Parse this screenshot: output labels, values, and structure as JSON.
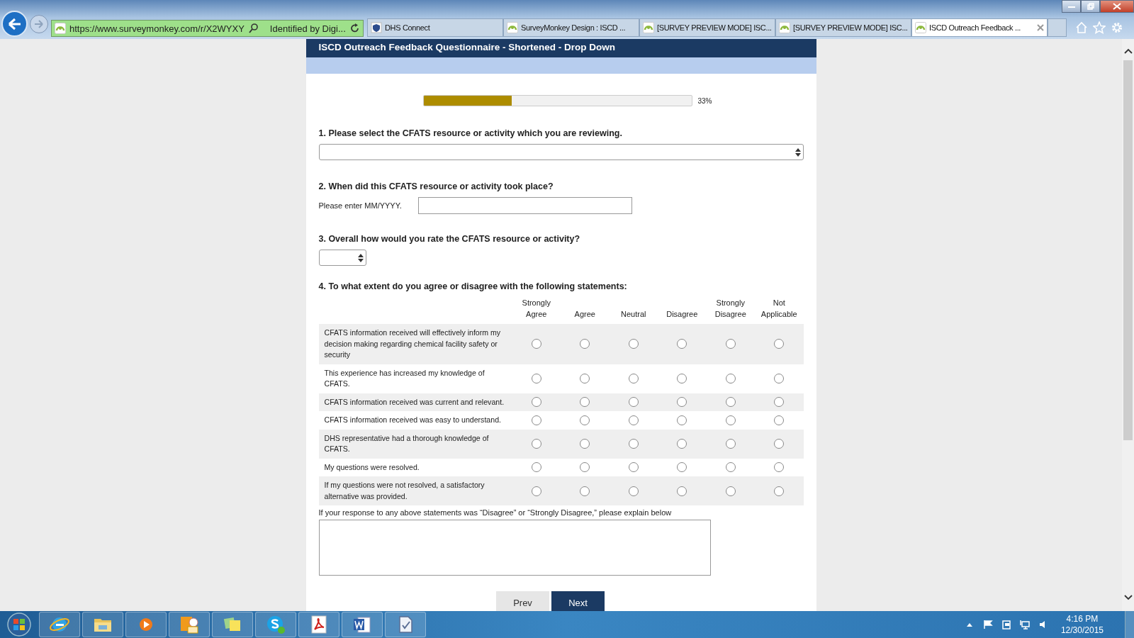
{
  "browser": {
    "address": "https://www.surveymonkey.com/r/X2WYXY",
    "identity": "Identified by Digi...",
    "tabs": [
      {
        "title": "DHS Connect",
        "selected": false
      },
      {
        "title": "SurveyMonkey Design : ISCD ...",
        "selected": false
      },
      {
        "title": "[SURVEY PREVIEW MODE] ISC...",
        "selected": false
      },
      {
        "title": "[SURVEY PREVIEW MODE] ISC...",
        "selected": false
      },
      {
        "title": "ISCD Outreach Feedback ...",
        "selected": true
      }
    ]
  },
  "survey": {
    "title": "ISCD Outreach Feedback Questionnaire - Shortened - Drop Down",
    "progress": {
      "level": 0.33,
      "label": "33%"
    },
    "questions": [
      {
        "kind": "dropdown",
        "title": "1. Please select the CFATS resource or activity which you are reviewing."
      },
      {
        "kind": "date",
        "title": "2. When did this CFATS resource or activity took place?",
        "prompt": "Please enter MM/YYYY."
      },
      {
        "kind": "rating",
        "title": "3. Overall how would you rate the CFATS resource or activity?"
      },
      {
        "kind": "matrix",
        "title": "4. To what extent do you agree or disagree with the following statements:",
        "columns": [
          "Strongly Agree",
          "Agree",
          "Neutral",
          "Disagree",
          "Strongly Disagree",
          "Not Applicable"
        ],
        "rows": [
          {
            "statement": "CFATS information received will effectively inform my decision making regarding chemical facility safety or security",
            "selected": [
              false,
              false,
              false,
              false,
              false,
              false
            ]
          },
          {
            "statement": "This experience has increased my knowledge of CFATS.",
            "selected": [
              false,
              false,
              false,
              false,
              false,
              false
            ]
          },
          {
            "statement": "CFATS information received was current and relevant.",
            "selected": [
              false,
              false,
              false,
              false,
              false,
              false
            ]
          },
          {
            "statement": "CFATS information received was easy to understand.",
            "selected": [
              false,
              false,
              false,
              false,
              false,
              false
            ]
          },
          {
            "statement": "DHS representative had a thorough knowledge of CFATS.",
            "selected": [
              false,
              false,
              false,
              false,
              false,
              false
            ]
          },
          {
            "statement": "My questions were resolved.",
            "selected": [
              false,
              false,
              false,
              false,
              false,
              false
            ]
          },
          {
            "statement": "If my questions were not resolved, a satisfactory alternative was provided.",
            "selected": [
              false,
              false,
              false,
              false,
              false,
              false
            ]
          }
        ]
      },
      {
        "kind": "comment",
        "prompt": "If your response to any above statements was “Disagree” or “Strongly Disagree,” please explain below"
      }
    ],
    "buttons": [
      {
        "label": "Prev",
        "kind": "secondary"
      },
      {
        "label": "Next",
        "kind": "primary"
      }
    ]
  },
  "taskbar": {
    "time": "4:16 PM",
    "date": "12/30/2015"
  }
}
